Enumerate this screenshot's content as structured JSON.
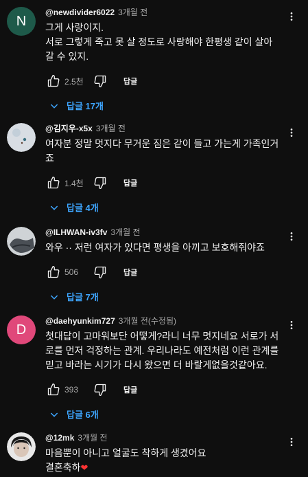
{
  "comments": [
    {
      "avatar_letter": "N",
      "avatar_color": "#1e5a4a",
      "author": "@newdivider6022",
      "time": "3개월 전",
      "lines": [
        "그게 사랑이지.",
        "서로 그렇게 죽고 못 살 정도로 사랑해야 한평생 같이 살아",
        "갈 수 있지."
      ],
      "likes": "2.5천",
      "reply_label": "답글",
      "replies_label": "답글 17개"
    },
    {
      "avatar_icon": "photo-avatar-icon",
      "author": "@김지우-x5x",
      "time": "3개월 전",
      "lines": [
        "여자분 정말 멋지다 무거운 짐은 같이 들고 가는게 가족인거",
        "죠"
      ],
      "likes": "1.4천",
      "reply_label": "답글",
      "replies_label": "답글 4개"
    },
    {
      "avatar_icon": "photo-avatar-icon",
      "author": "@ILHWAN-iv3fv",
      "time": "3개월 전",
      "lines": [
        "와우 ·· 저런 여자가 있다면 평생을 아끼고 보호해줘야죠"
      ],
      "likes": "506",
      "reply_label": "답글",
      "replies_label": "답글 7개"
    },
    {
      "avatar_letter": "D",
      "avatar_color": "#e0487a",
      "author": "@daehyunkim727",
      "time": "3개월 전(수정됨)",
      "lines": [
        "첫대답이 고마워보단 어떻게?라니 너무 멋지네요 서로가 서",
        "로를 먼저 걱정하는 관계.  우리나라도 예전처럼 이런 관계를",
        "믿고 바라는 시기가 다시 왔으면 더 바랄게없을것같아요."
      ],
      "likes": "393",
      "reply_label": "답글",
      "replies_label": "답글 6개"
    },
    {
      "avatar_icon": "photo-avatar-icon",
      "author": "@12mk",
      "time": "3개월 전",
      "lines": [
        "마음뿐이 아니고 얼굴도 착하게 생겼어요",
        "결혼축하"
      ]
    }
  ]
}
